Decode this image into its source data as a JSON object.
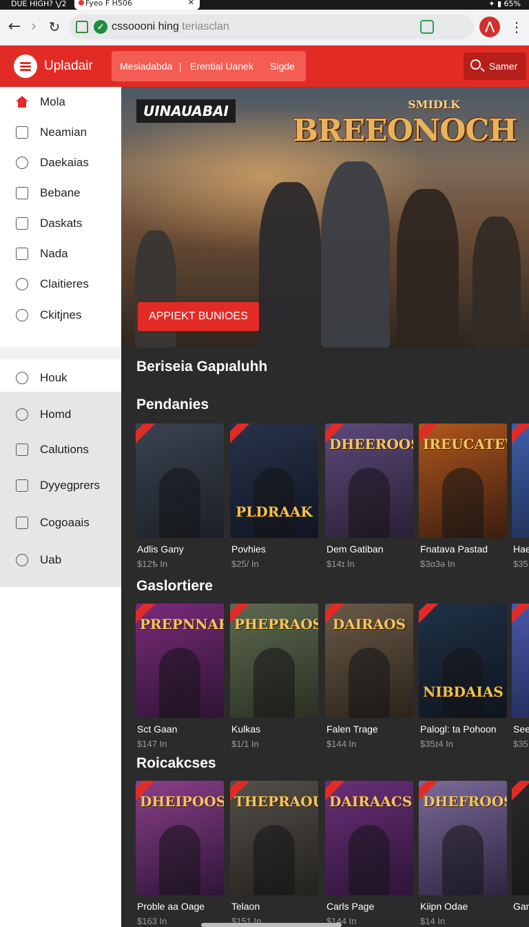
{
  "status_bar": {
    "left": "DUE HIGH? ⋁2",
    "tab_title": "Fyeo F H506",
    "right": "✦ ▮ 65%"
  },
  "browser": {
    "url_domain": "cssoooni hing",
    "url_path": " teriasclan",
    "back_icon": "back-arrow-icon",
    "forward_icon": "forward-arrow-icon",
    "reload_icon": "reload-icon"
  },
  "header": {
    "brand": "Upladair",
    "nav": [
      "Mesiadabda",
      "Erential Uanek",
      "Sigde"
    ],
    "search_label": "Samer"
  },
  "sidebar": {
    "items_top": [
      {
        "label": "Mola",
        "icon": "home-icon"
      },
      {
        "label": "Neamian",
        "icon": "edit-icon"
      },
      {
        "label": "Daekaias",
        "icon": "search-icon"
      },
      {
        "label": "Bebane",
        "icon": "image-icon"
      },
      {
        "label": "Daskats",
        "icon": "pencil-icon"
      },
      {
        "label": "Nada",
        "icon": "box-icon"
      },
      {
        "label": "Claitieres",
        "icon": "circle-icon"
      },
      {
        "label": "Ckitjnes",
        "icon": "settings-icon"
      }
    ],
    "items_bottom": [
      {
        "label": "Houk",
        "icon": "clock-icon"
      },
      {
        "label": "Homd",
        "icon": "hand-icon"
      },
      {
        "label": "Calutions",
        "icon": "square-icon"
      },
      {
        "label": "Dyyegprers",
        "icon": "layers-icon"
      },
      {
        "label": "Cogoaais",
        "icon": "square-icon"
      },
      {
        "label": "Uab",
        "icon": "chat-icon"
      }
    ]
  },
  "hero": {
    "tag": "UINAUABAI",
    "subtitle": "SMIDLK",
    "title": "BREEONOCH",
    "cta": "APPIEKT BUNIOES"
  },
  "main": {
    "heading": "Beriseia Gapıaluhh",
    "sections": [
      {
        "title": "Pendanies",
        "cards": [
          {
            "name": "Adlis Gany",
            "price": "$12ѣ In",
            "art_title": "",
            "colors": [
              "#3a4350",
              "#1b1f27"
            ]
          },
          {
            "name": "Povhies",
            "price": "$25/ In",
            "art_title": "PLDRAAK",
            "colors": [
              "#27324a",
              "#101522"
            ]
          },
          {
            "name": "Dem Gatiban",
            "price": "$14ɪ In",
            "art_title": "DHEEROOS",
            "colors": [
              "#5b4a7a",
              "#2a1f33"
            ]
          },
          {
            "name": "Fnatava Pastad",
            "price": "$3ɑ3ə In",
            "art_title": "IREUCATEWIA",
            "colors": [
              "#b0571c",
              "#3a1d10"
            ]
          },
          {
            "name": "Hae",
            "price": "$35",
            "art_title": "",
            "colors": [
              "#3f5fa8",
              "#1c2b4f"
            ]
          }
        ]
      },
      {
        "title": "Gaslortiere",
        "cards": [
          {
            "name": "Sct Gaan",
            "price": "$147 In",
            "art_title": "PREPNNARS",
            "colors": [
              "#7a2b7a",
              "#2d1433"
            ]
          },
          {
            "name": "Kulkas",
            "price": "$1/1 In",
            "art_title": "PHEPRAOS",
            "colors": [
              "#5c6a50",
              "#2a2f22"
            ]
          },
          {
            "name": "Falen Trage",
            "price": "$144 In",
            "art_title": "DAIRAOS",
            "colors": [
              "#6a5a48",
              "#2b2219"
            ]
          },
          {
            "name": "Palogl: ta Pohoon",
            "price": "$35ɪ4 In",
            "art_title": "NIBDAIAS",
            "colors": [
              "#203046",
              "#0e1520"
            ]
          },
          {
            "name": "See",
            "price": "$35",
            "art_title": "",
            "colors": [
              "#4a58a8",
              "#1e2550"
            ]
          }
        ]
      },
      {
        "title": "Roicakcses",
        "cards": [
          {
            "name": "Proble aa Oage",
            "price": "$163 In",
            "art_title": "DHEIPOOS",
            "colors": [
              "#8a3f8a",
              "#2f1538"
            ]
          },
          {
            "name": "Telaon",
            "price": "$151 In",
            "art_title": "THEPRAOUS",
            "colors": [
              "#54504a",
              "#23211e"
            ]
          },
          {
            "name": "Carls Page",
            "price": "$144 In",
            "art_title": "DAIRAACS",
            "colors": [
              "#6a2f7a",
              "#2c1535"
            ]
          },
          {
            "name": "Kiipn Odae",
            "price": "$14 In",
            "art_title": "DHEFROOS",
            "colors": [
              "#7a6a9a",
              "#2e2540"
            ]
          },
          {
            "name": "Gan",
            "price": "",
            "art_title": "",
            "colors": [
              "#2a2a2a",
              "#141414"
            ]
          }
        ]
      }
    ]
  },
  "colors": {
    "accent": "#e32b26",
    "nav_bg": "#f35d54",
    "search_bg": "#b71f1b",
    "main_bg": "#2b2b2b"
  }
}
